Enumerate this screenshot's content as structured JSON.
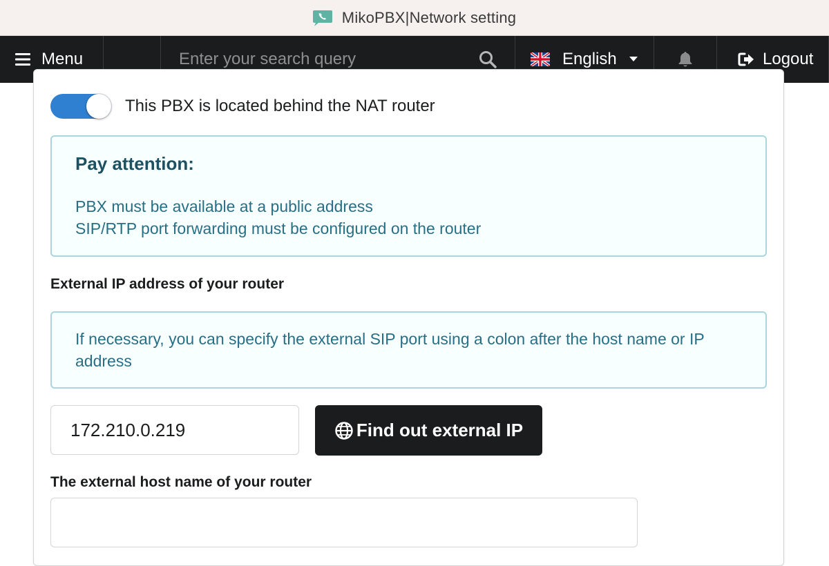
{
  "window": {
    "title": "MikoPBX|Network setting",
    "app_icon": "phone-chat-icon"
  },
  "topbar": {
    "menu_label": "Menu",
    "search_placeholder": "Enter your search query",
    "search_value": "",
    "language_label": "English",
    "language_flag": "uk-flag-icon",
    "logout_label": "Logout"
  },
  "nat": {
    "toggle_label": "This PBX is located behind the NAT router",
    "toggle_on": true,
    "attention_header": "Pay attention:",
    "attention_lines": [
      "PBX must be available at a public address",
      "SIP/RTP port forwarding must be configured on the router"
    ],
    "external_ip_label": "External IP address of your router",
    "external_ip_hint": "If necessary, you can specify the external SIP port using a colon after the host name or IP address",
    "external_ip_value": "172.210.0.219",
    "find_ip_button": "Find out external IP",
    "external_host_label": "The external host name of your router",
    "external_host_value": ""
  },
  "colors": {
    "topbar_bg": "#1b1c1d",
    "toggle_on": "#2f80d1",
    "info_text": "#276f86",
    "info_bg": "#f8ffff",
    "info_border": "#a9d5de"
  }
}
